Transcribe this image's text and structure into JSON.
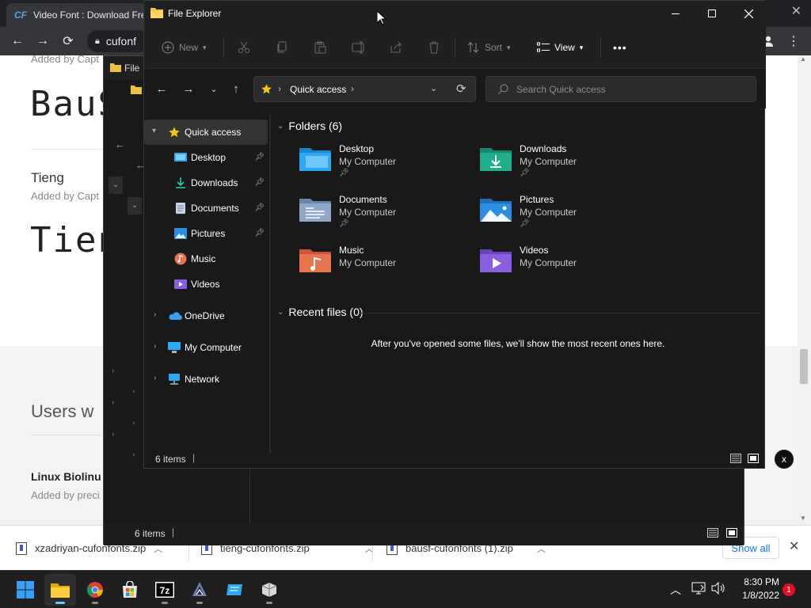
{
  "chrome": {
    "tab_title": "Video Font : Download Fre",
    "tab_logo": "CF",
    "omnibox_text": "cufonf",
    "page": {
      "added_by_top": "Added by Capt",
      "font_bauhaus_preview": "BauS",
      "font_tieng_name": "Tieng",
      "font_tieng_added": "Added by Capt",
      "font_tieng_preview": "Tien",
      "users_heading": "Users w",
      "font_linux_name": "Linux Biolinu",
      "font_linux_added": "Added by preci",
      "close_btn": "x"
    },
    "downloads": [
      {
        "file": "xzadriyan-cufonfonts.zip"
      },
      {
        "file": "tieng-cufonfonts.zip"
      },
      {
        "file": "bausf-cufonfonts (1).zip"
      }
    ],
    "show_all": "Show all"
  },
  "explorer_back": {
    "title": "File",
    "status": "6 items"
  },
  "explorer": {
    "title": "File Explorer",
    "toolbar": {
      "new_label": "New",
      "sort_label": "Sort",
      "view_label": "View",
      "more_label": "•••"
    },
    "address": {
      "location": "Quick access",
      "search_placeholder": "Search Quick access"
    },
    "nav": {
      "quick_access": "Quick access",
      "pinned": [
        {
          "label": "Desktop",
          "icon": "desktop-icon",
          "pinned": true
        },
        {
          "label": "Downloads",
          "icon": "downloads-icon",
          "pinned": true
        },
        {
          "label": "Documents",
          "icon": "documents-icon",
          "pinned": true
        },
        {
          "label": "Pictures",
          "icon": "pictures-icon",
          "pinned": true
        },
        {
          "label": "Music",
          "icon": "music-icon",
          "pinned": false
        },
        {
          "label": "Videos",
          "icon": "videos-icon",
          "pinned": false
        }
      ],
      "onedrive": "OneDrive",
      "my_computer": "My Computer",
      "network": "Network"
    },
    "folders_header": "Folders (6)",
    "folders": [
      {
        "name": "Desktop",
        "location": "My Computer",
        "pinned": true,
        "color": "#2ea8f0"
      },
      {
        "name": "Downloads",
        "location": "My Computer",
        "pinned": true,
        "color": "#1fae8c"
      },
      {
        "name": "Documents",
        "location": "My Computer",
        "pinned": true,
        "color": "#8fa7c8"
      },
      {
        "name": "Pictures",
        "location": "My Computer",
        "pinned": true,
        "color": "#2b8ee0"
      },
      {
        "name": "Music",
        "location": "My Computer",
        "pinned": false,
        "color": "#e8744f"
      },
      {
        "name": "Videos",
        "location": "My Computer",
        "pinned": false,
        "color": "#8a5ee0"
      }
    ],
    "recent_header": "Recent files (0)",
    "recent_empty": "After you've opened some files, we'll show the most recent ones here.",
    "status": "6 items"
  },
  "taskbar": {
    "time": "8:30 PM",
    "date": "1/8/2022",
    "notifications": "1",
    "apps": [
      "start-icon",
      "file-explorer-icon",
      "chrome-icon",
      "store-icon",
      "7zip-icon",
      "inkscape-icon",
      "app-icon",
      "app2-icon"
    ]
  }
}
